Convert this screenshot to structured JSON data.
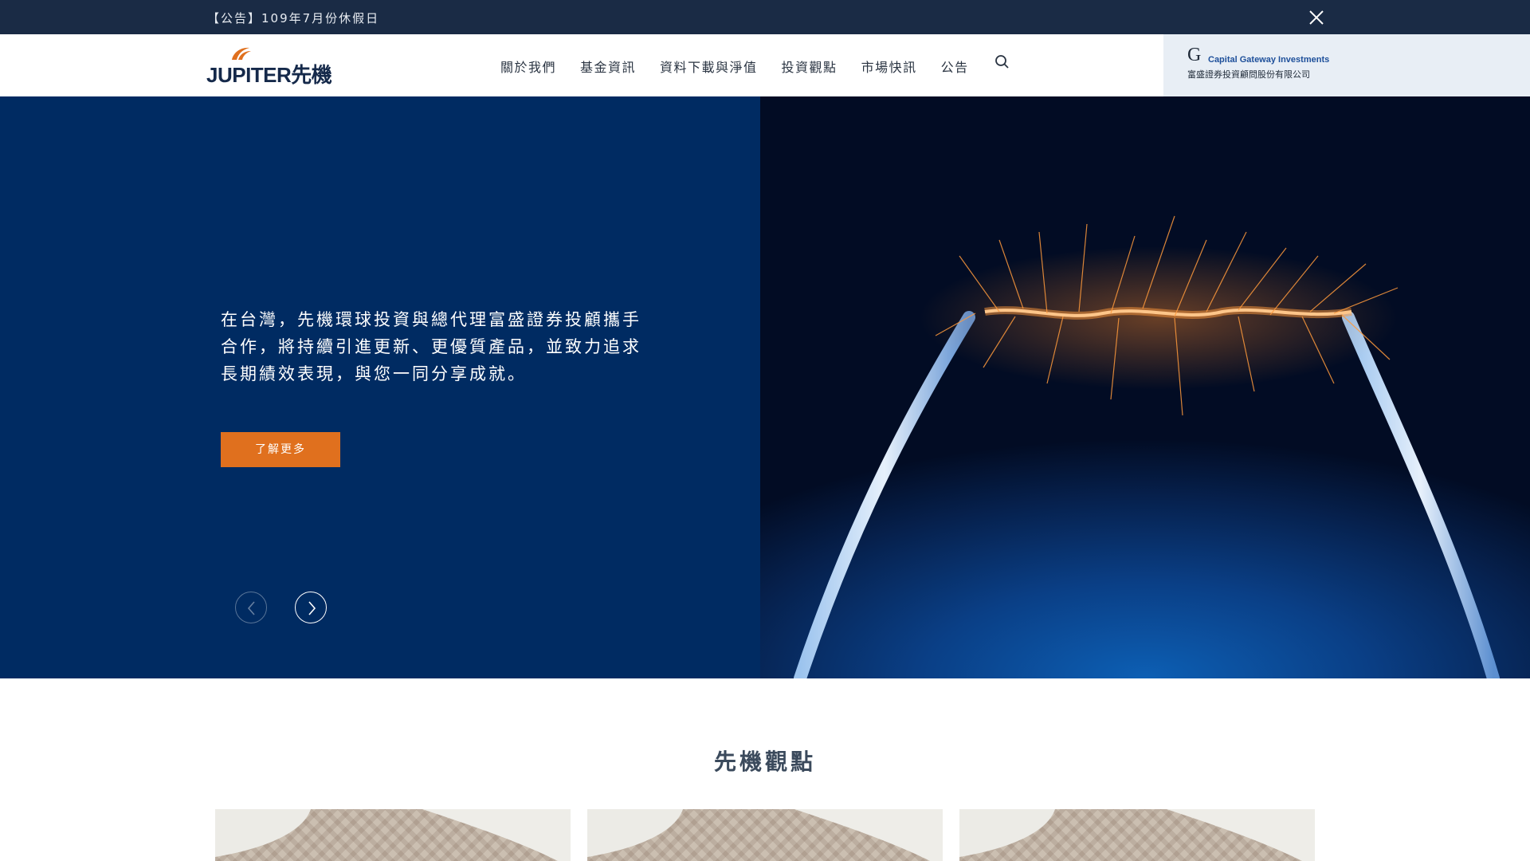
{
  "announcement": {
    "text": "【公告】109年7月份休假日",
    "close_icon": "close-icon"
  },
  "header": {
    "logo": {
      "text": "JUPITER先機",
      "swoosh_color": "#e0701e",
      "text_color": "#15294a"
    },
    "nav": [
      {
        "label": "關於我們"
      },
      {
        "label": "基金資訊"
      },
      {
        "label": "資料下載與淨值"
      },
      {
        "label": "投資觀點"
      },
      {
        "label": "市場快訊"
      },
      {
        "label": "公告"
      }
    ],
    "search_icon": "search-icon",
    "partner": {
      "mark": "G",
      "name_en": "Capital Gateway Investments",
      "name_zh": "富盛證券投資顧問股份有限公司"
    }
  },
  "hero": {
    "text": "在台灣，先機環球投資與總代理富盛證券投顧攜手合作，將持續引進更新、更優質產品，並致力追求長期績效表現，與您一同分享成就。",
    "cta_label": "了解更多",
    "prev_icon": "chevron-left-icon",
    "next_icon": "chevron-right-icon",
    "background_color": "#002b62",
    "accent_color": "#e0701e"
  },
  "insights": {
    "title": "先機觀點",
    "cards": [
      {
        "image": "paving-image"
      },
      {
        "image": "paving-image"
      },
      {
        "image": "paving-image"
      }
    ]
  }
}
